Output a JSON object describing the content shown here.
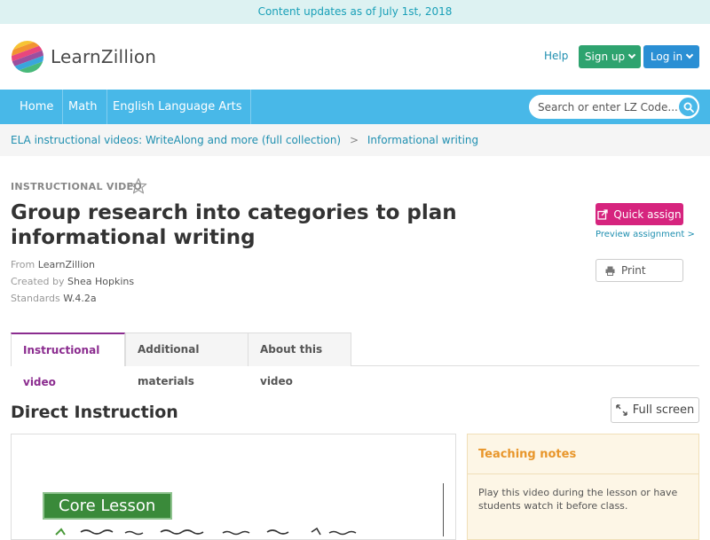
{
  "banner": {
    "text": "Content updates as of July 1st, 2018"
  },
  "brand": {
    "name": "LearnZillion"
  },
  "header": {
    "help": "Help",
    "signup": "Sign up",
    "login": "Log in"
  },
  "nav": {
    "items": [
      {
        "label": "Home"
      },
      {
        "label": "Math"
      },
      {
        "label": "English Language Arts"
      }
    ],
    "search_placeholder": "Search or enter LZ Code..."
  },
  "breadcrumb": {
    "parent": "ELA instructional videos: WriteAlong and more (full collection)",
    "separator": ">",
    "current": "Informational writing"
  },
  "lesson": {
    "kind": "INSTRUCTIONAL VIDEO",
    "title": "Group research into categories to plan informational writing",
    "from_label": "From",
    "from_value": "LearnZillion",
    "created_label": "Created by",
    "created_value": "Shea Hopkins",
    "standards_label": "Standards",
    "standards_value": "W.4.2a"
  },
  "actions": {
    "quick_assign": "Quick assign",
    "preview": "Preview assignment >",
    "print": "Print"
  },
  "tabs": [
    {
      "label": "Instructional video",
      "active": true
    },
    {
      "label": "Additional materials",
      "active": false
    },
    {
      "label": "About this video",
      "active": false
    }
  ],
  "section": {
    "title": "Direct Instruction",
    "fullscreen": "Full screen"
  },
  "video": {
    "badge": "Core Lesson"
  },
  "notes": {
    "heading": "Teaching notes",
    "body": "Play this video during the lesson or have students watch it before class."
  },
  "colors": {
    "nav": "#48b8e8",
    "signup": "#2ea36f",
    "login": "#2a8fd4",
    "quick_assign": "#d6247e",
    "active_tab": "#8b2c8f",
    "notes_heading": "#e8962b"
  }
}
